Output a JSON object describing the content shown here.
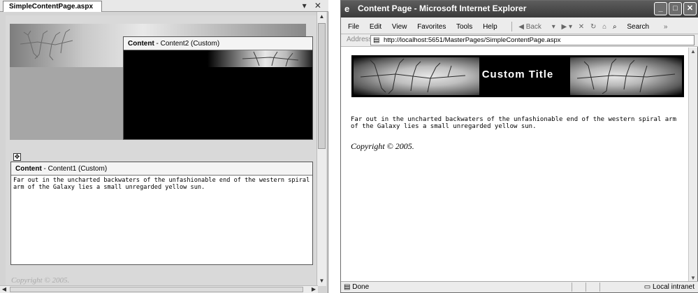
{
  "designer": {
    "tab_title": "SimpleContentPage.aspx",
    "tab_controls": "▾ ✕",
    "content2": {
      "label_bold": "Content",
      "label_rest": " - Content2 (Custom)"
    },
    "content1": {
      "label_bold": "Content",
      "label_rest": " - Content1 (Custom)",
      "text": "Far out in the uncharted backwaters of the unfashionable end of the western spiral arm of the Galaxy lies a small unregarded yellow sun."
    },
    "move_handle_glyph": "✥",
    "copyright": "Copyright © 2005."
  },
  "browser": {
    "title": "Content Page - Microsoft Internet Explorer",
    "window_buttons": [
      "_",
      "□",
      "✕"
    ],
    "menu": [
      "File",
      "Edit",
      "View",
      "Favorites",
      "Tools",
      "Help"
    ],
    "toolbar": {
      "back": "Back",
      "search": "Search"
    },
    "address_label": "Address",
    "address_url": "http://localhost:5651/MasterPages/SimpleContentPage.aspx",
    "banner_title": "Custom Title",
    "body_text": "Far out in the uncharted backwaters of the unfashionable end of the western spiral arm of the Galaxy lies a small unregarded yellow sun.",
    "copyright": "Copyright © 2005.",
    "status_left": "Done",
    "status_zone": "Local intranet"
  },
  "icons": {
    "ie_logo": "e",
    "page_icon": "page-icon",
    "scroll_up": "▲",
    "scroll_down": "▼",
    "scroll_left": "◀",
    "scroll_right": "▶"
  }
}
